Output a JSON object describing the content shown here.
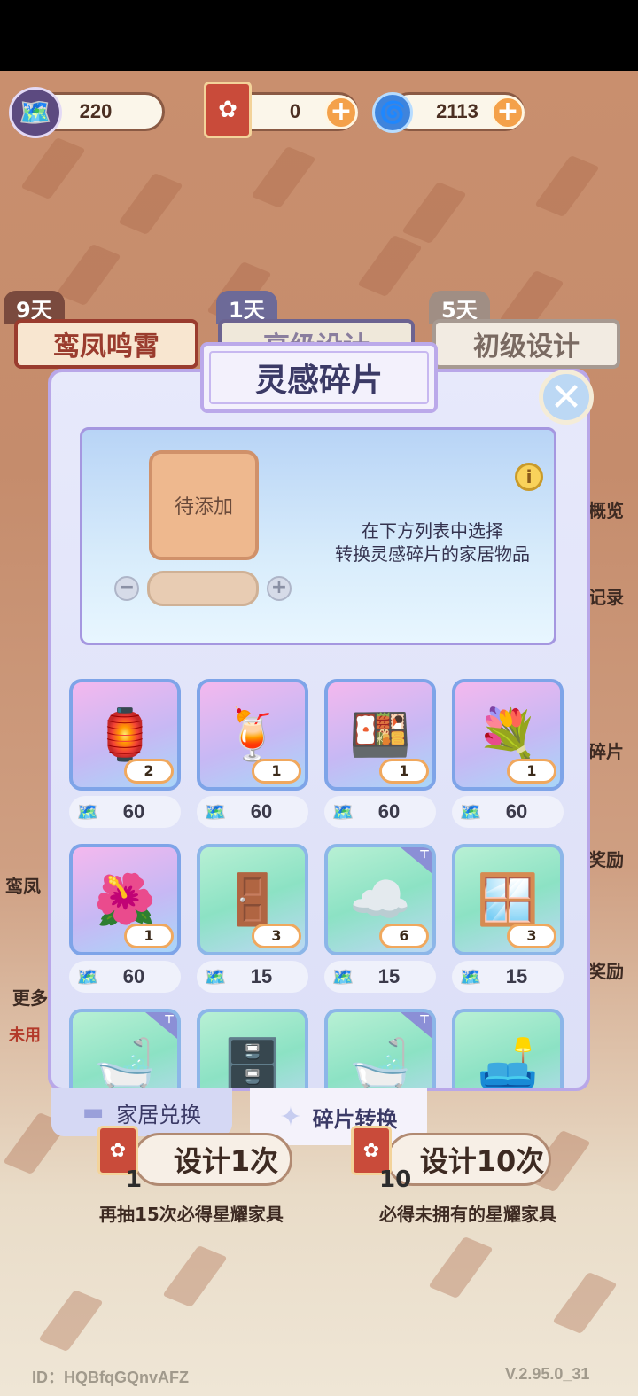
{
  "currency": {
    "fragments": "220",
    "tickets": "0",
    "gems": "2113",
    "plus": "+"
  },
  "pools": [
    {
      "days": "9天",
      "name": "鸾凤鸣霄"
    },
    {
      "days": "1天",
      "name": "高级设计"
    },
    {
      "days": "5天",
      "name": "初级设计"
    }
  ],
  "side": {
    "overview": "概览",
    "record": "记录",
    "fragments": "碎片",
    "reward1": "奖励",
    "reward2": "奖励",
    "left_name": "鸾凤",
    "left_more": "更多",
    "left_unused": "未用"
  },
  "dialog": {
    "title": "灵感碎片",
    "close": "✕",
    "slot_label": "待添加",
    "minus": "−",
    "plus": "+",
    "info": "i",
    "hint_line1": "在下方列表中选择",
    "hint_line2": "转换灵感碎片的家居物品",
    "items": [
      {
        "count": "2",
        "price": "60",
        "art": "🏮",
        "bg": "purple",
        "tag": false
      },
      {
        "count": "1",
        "price": "60",
        "art": "🍹",
        "bg": "purple",
        "tag": false
      },
      {
        "count": "1",
        "price": "60",
        "art": "🍱",
        "bg": "purple",
        "tag": false
      },
      {
        "count": "1",
        "price": "60",
        "art": "💐",
        "bg": "purple",
        "tag": false
      },
      {
        "count": "1",
        "price": "60",
        "art": "🌺",
        "bg": "purple",
        "tag": false
      },
      {
        "count": "3",
        "price": "15",
        "art": "🚪",
        "bg": "green",
        "tag": false
      },
      {
        "count": "6",
        "price": "15",
        "art": "☁️",
        "bg": "green",
        "tag": true
      },
      {
        "count": "3",
        "price": "15",
        "art": "🪟",
        "bg": "green",
        "tag": false
      },
      {
        "count": "",
        "price": "",
        "art": "🛁",
        "bg": "green",
        "tag": true
      },
      {
        "count": "",
        "price": "",
        "art": "🗄️",
        "bg": "green",
        "tag": false
      },
      {
        "count": "",
        "price": "",
        "art": "🛁",
        "bg": "green",
        "tag": true
      },
      {
        "count": "",
        "price": "",
        "art": "🛋️",
        "bg": "green",
        "tag": false
      }
    ],
    "tabs": {
      "exchange": "家居兑换",
      "convert": "碎片转换"
    }
  },
  "draw": {
    "one_label": "设计1次",
    "one_count": "1",
    "one_note": "再抽15次必得星耀家具",
    "ten_label": "设计10次",
    "ten_count": "10",
    "ten_note": "必得未拥有的星耀家具"
  },
  "footer": {
    "id": "ID：HQBfqGQnvAFZ",
    "version": "V.2.95.0_31"
  }
}
